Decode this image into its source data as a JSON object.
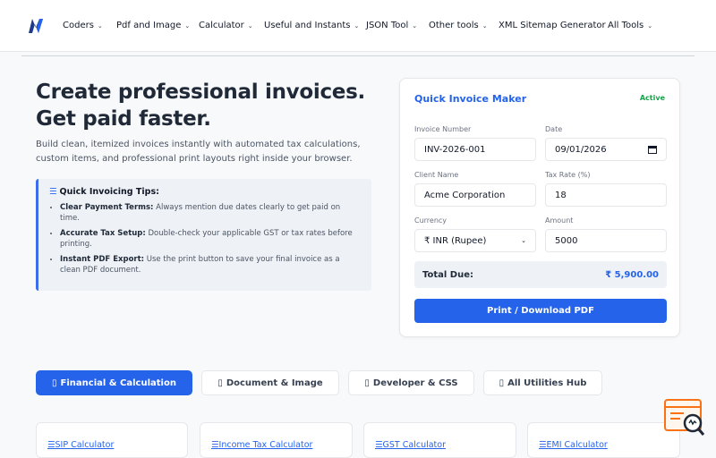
{
  "nav": {
    "items": [
      {
        "label": "Coders",
        "has_menu": true
      },
      {
        "label": "Pdf and Image",
        "has_menu": true
      },
      {
        "label": "Calculator",
        "has_menu": true
      },
      {
        "label": "Useful and Instants",
        "has_menu": true
      },
      {
        "label": "JSON Tool",
        "has_menu": true
      },
      {
        "label": "Other tools",
        "has_menu": true
      },
      {
        "label": "XML Sitemap Generator",
        "has_menu": false
      },
      {
        "label": "All Tools",
        "has_menu": true
      }
    ],
    "chevron": "⌄"
  },
  "hero": {
    "title_line1": "Create professional invoices.",
    "title_line2": "Get paid faster.",
    "subtitle": "Build clean, itemized invoices instantly with automated tax calculations, custom items, and professional print layouts right inside your browser."
  },
  "tips": {
    "heading": "Quick Invoicing Tips:",
    "items": [
      {
        "bold": "Clear Payment Terms:",
        "text": " Always mention due dates clearly to get paid on time."
      },
      {
        "bold": "Accurate Tax Setup:",
        "text": " Double-check your applicable GST or tax rates before printing."
      },
      {
        "bold": "Instant PDF Export:",
        "text": " Use the print button to save your final invoice as a clean PDF document."
      }
    ]
  },
  "invoice": {
    "title": "Quick Invoice Maker",
    "badge": "Active",
    "invoice_number_label": "Invoice Number",
    "invoice_number": "INV-2026-001",
    "date_label": "Date",
    "date": "09/01/2026",
    "client_label": "Client Name",
    "client": "Acme Corporation",
    "tax_label": "Tax Rate (%)",
    "tax": "18",
    "currency_label": "Currency",
    "currency": "₹ INR (Rupee)",
    "amount_label": "Amount",
    "amount": "5000",
    "total_label": "Total Due:",
    "total_value": "₹ 5,900.00",
    "print_label": "Print / Download PDF"
  },
  "tabs": [
    {
      "label": "Financial & Calculation",
      "active": true
    },
    {
      "label": "Document & Image",
      "active": false
    },
    {
      "label": "Developer & CSS",
      "active": false
    },
    {
      "label": "All Utilities Hub",
      "active": false
    }
  ],
  "tools": [
    {
      "label": "SIP Calculator"
    },
    {
      "label": "Income Tax Calculator"
    },
    {
      "label": "GST Calculator"
    },
    {
      "label": "EMI Calculator"
    }
  ],
  "colors": {
    "accent": "#2563eb",
    "badge": "#16a34a",
    "logo": "#1e3a8a"
  },
  "icons": {
    "tab_glyph": "▯",
    "tool_glyph": "☰",
    "tips_glyph": "☰"
  }
}
